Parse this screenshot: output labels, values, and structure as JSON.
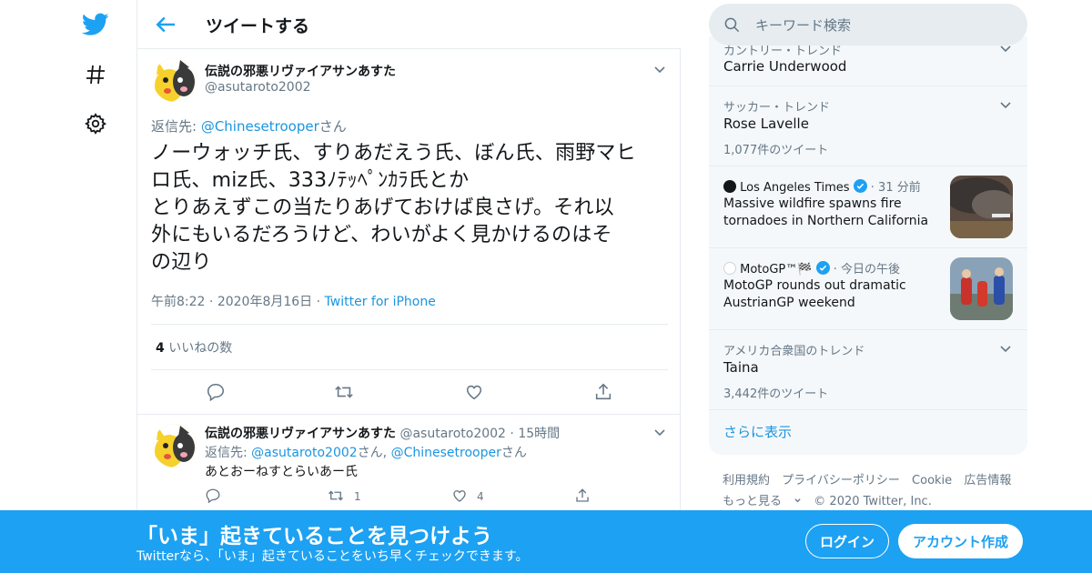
{
  "header": {
    "title": "ツイートする"
  },
  "main_tweet": {
    "display_name": "伝説の邪悪リヴァイアサンあすた",
    "handle": "@asutaroto2002",
    "reply_prefix": "返信先: ",
    "reply_to": "@Chinesetrooper",
    "reply_suffix": "さん",
    "text_line1": "ノーウォッチ氏、すりあだえう氏、ぼん氏、雨野マヒ",
    "text_line2": "ロ氏、miz氏、333ﾉﾃｯﾍﾟﾝｶﾗ氏とか",
    "text_line3": "とりあえずこの当たりあげておけば良さげ。それ以",
    "text_line4": "外にもいるだろうけど、わいがよく見かけるのはそ",
    "text_line5": "の辺り",
    "time": "午前8:22",
    "date": "2020年8月16日",
    "source": "Twitter for iPhone",
    "likes_count": "4",
    "likes_label": "いいねの数"
  },
  "reply_tweet": {
    "display_name": "伝説の邪悪リヴァイアサンあすた",
    "handle": "@asutaroto2002",
    "time": "15時間",
    "reply_prefix": "返信先: ",
    "reply_to1": "@asutaroto2002",
    "reply_mid": "さん, ",
    "reply_to2": "@Chinesetrooper",
    "reply_suffix": "さん",
    "text": "あとおーねすとらいあー氏",
    "retweets": "1",
    "likes": "4"
  },
  "search": {
    "placeholder": "キーワード検索"
  },
  "trends": [
    {
      "meta": "カントリー・トレンド",
      "name": "Carrie Underwood"
    },
    {
      "meta": "サッカー・トレンド",
      "name": "Rose Lavelle",
      "count": "1,077件のツイート"
    },
    {
      "source": "Los Angeles Times",
      "time": "31 分前",
      "headline1": "Massive wildfire spawns fire",
      "headline2": "tornadoes in Northern California"
    },
    {
      "source": "MotoGP™🏁",
      "time": "今日の午後",
      "headline1": "MotoGP rounds out dramatic",
      "headline2": "AustrianGP weekend"
    },
    {
      "meta": "アメリカ合衆国のトレンド",
      "name": "Taina",
      "count": "3,442件のツイート"
    }
  ],
  "show_more": "さらに表示",
  "footer": {
    "links": [
      "利用規約",
      "プライバシーポリシー",
      "Cookie",
      "広告情報"
    ],
    "more": "もっと見る",
    "copyright": "© 2020 Twitter, Inc."
  },
  "banner": {
    "headline": "「いま」起きていることを見つけよう",
    "sub": "Twitterなら、「いま」起きていることをいち早くチェックできます。",
    "login": "ログイン",
    "signup": "アカウント作成"
  },
  "colors": {
    "accent": "#1da1f2",
    "link": "#1b95e0",
    "text": "#14171a",
    "muted": "#657786"
  }
}
